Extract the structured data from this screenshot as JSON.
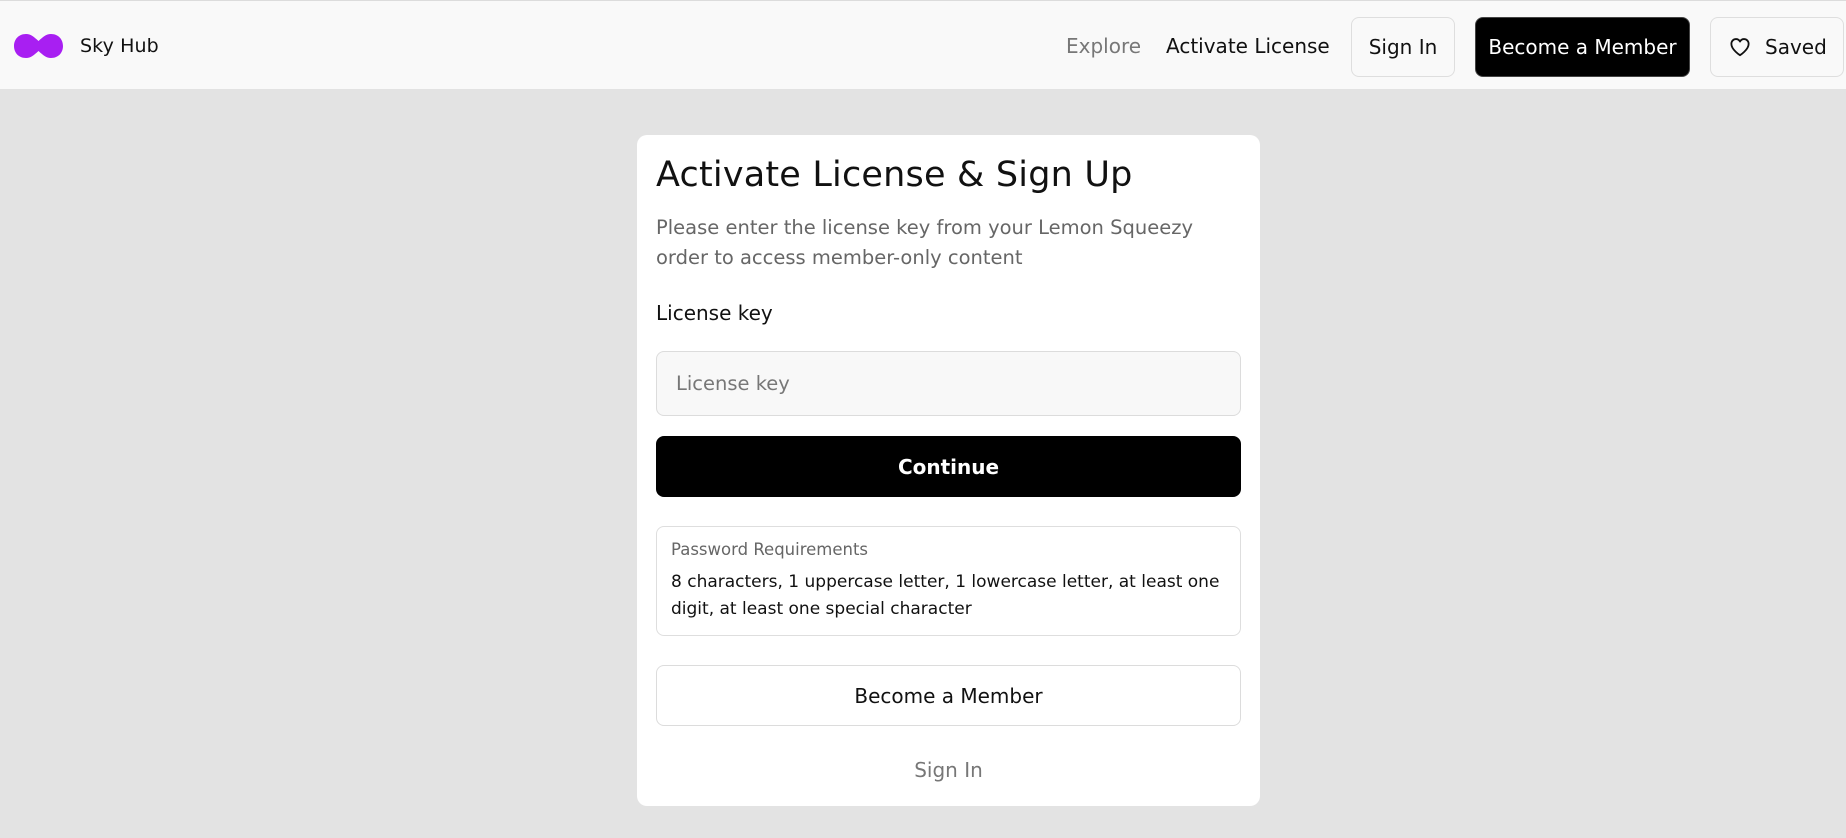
{
  "brand": {
    "name": "Sky Hub",
    "logo_color": "#a81ff2"
  },
  "nav": {
    "explore": "Explore",
    "activate_license": "Activate License",
    "sign_in": "Sign In",
    "become_member": "Become a Member",
    "saved": "Saved"
  },
  "card": {
    "title": "Activate License & Sign Up",
    "subtitle": "Please enter the license key from your Lemon Squeezy order to access member-only content",
    "license_label": "License key",
    "license_placeholder": "License key",
    "license_value": "",
    "continue": "Continue",
    "requirements_title": "Password Requirements",
    "requirements_text": "8 characters, 1 uppercase letter, 1 lowercase letter, at least one digit, at least one special character",
    "become_member": "Become a Member",
    "sign_in": "Sign In"
  },
  "icons": {
    "logo": "sky-hub-logo",
    "saved": "heart-icon"
  },
  "colors": {
    "accent": "#a81ff2",
    "primary_button": "#000000",
    "page_background": "#e3e3e3"
  }
}
